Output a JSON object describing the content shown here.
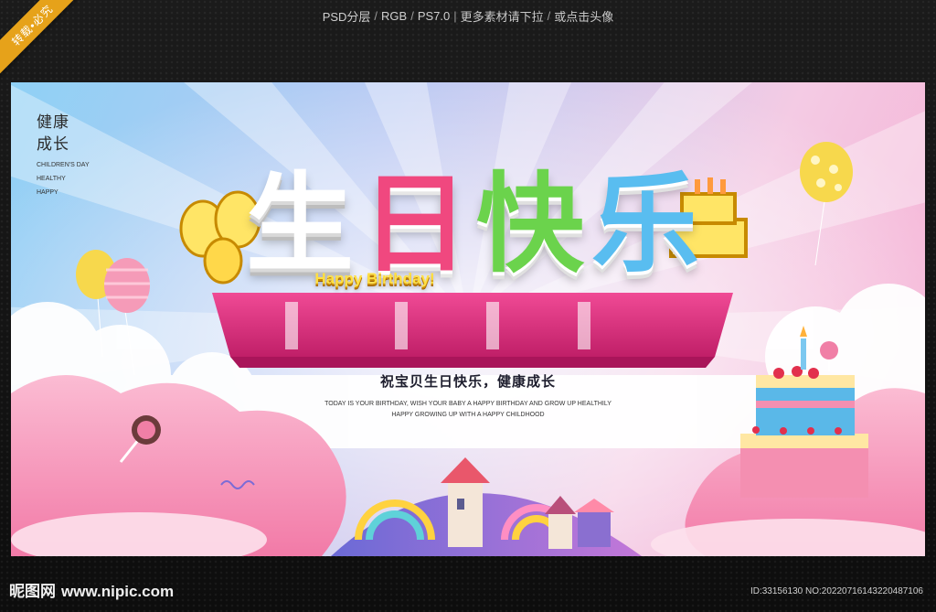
{
  "top_bar": {
    "format": "PSD分层",
    "color_mode": "RGB",
    "version": "PS7.0",
    "more": "更多素材请下拉",
    "or_click": "或点击头像"
  },
  "ribbon": {
    "text": "转载•必究"
  },
  "poster": {
    "left_text": {
      "line1": "健康",
      "line2": "成长",
      "en1": "CHILDREN'S DAY",
      "en2": "HEALTHY",
      "en3": "HAPPY"
    },
    "title_chars": [
      "生",
      "日",
      "快",
      "乐"
    ],
    "happy_birthday": "Happy Birthday!",
    "headline": "祝宝贝生日快乐，健康成长",
    "subline1": "TODAY IS YOUR BIRTHDAY, WISH YOUR BABY A HAPPY BIRTHDAY AND GROW UP HEALTHILY",
    "subline2": "HAPPY GROWING UP WITH A HAPPY CHILDHOOD"
  },
  "footer": {
    "logo": "昵图网",
    "url": "www.nipic.com",
    "id_line": "ID:33156130 NO:20220716143220487106"
  },
  "colors": {
    "ribbon": "#e6a21a",
    "pink_base": "#e33a86",
    "cloud_pink": "#f58db4",
    "char_white": "#ffffff",
    "char_pink": "#f0487f",
    "char_green": "#6bd34c",
    "char_blue": "#59bdf0",
    "balloon_yellow": "#f7d84c"
  }
}
